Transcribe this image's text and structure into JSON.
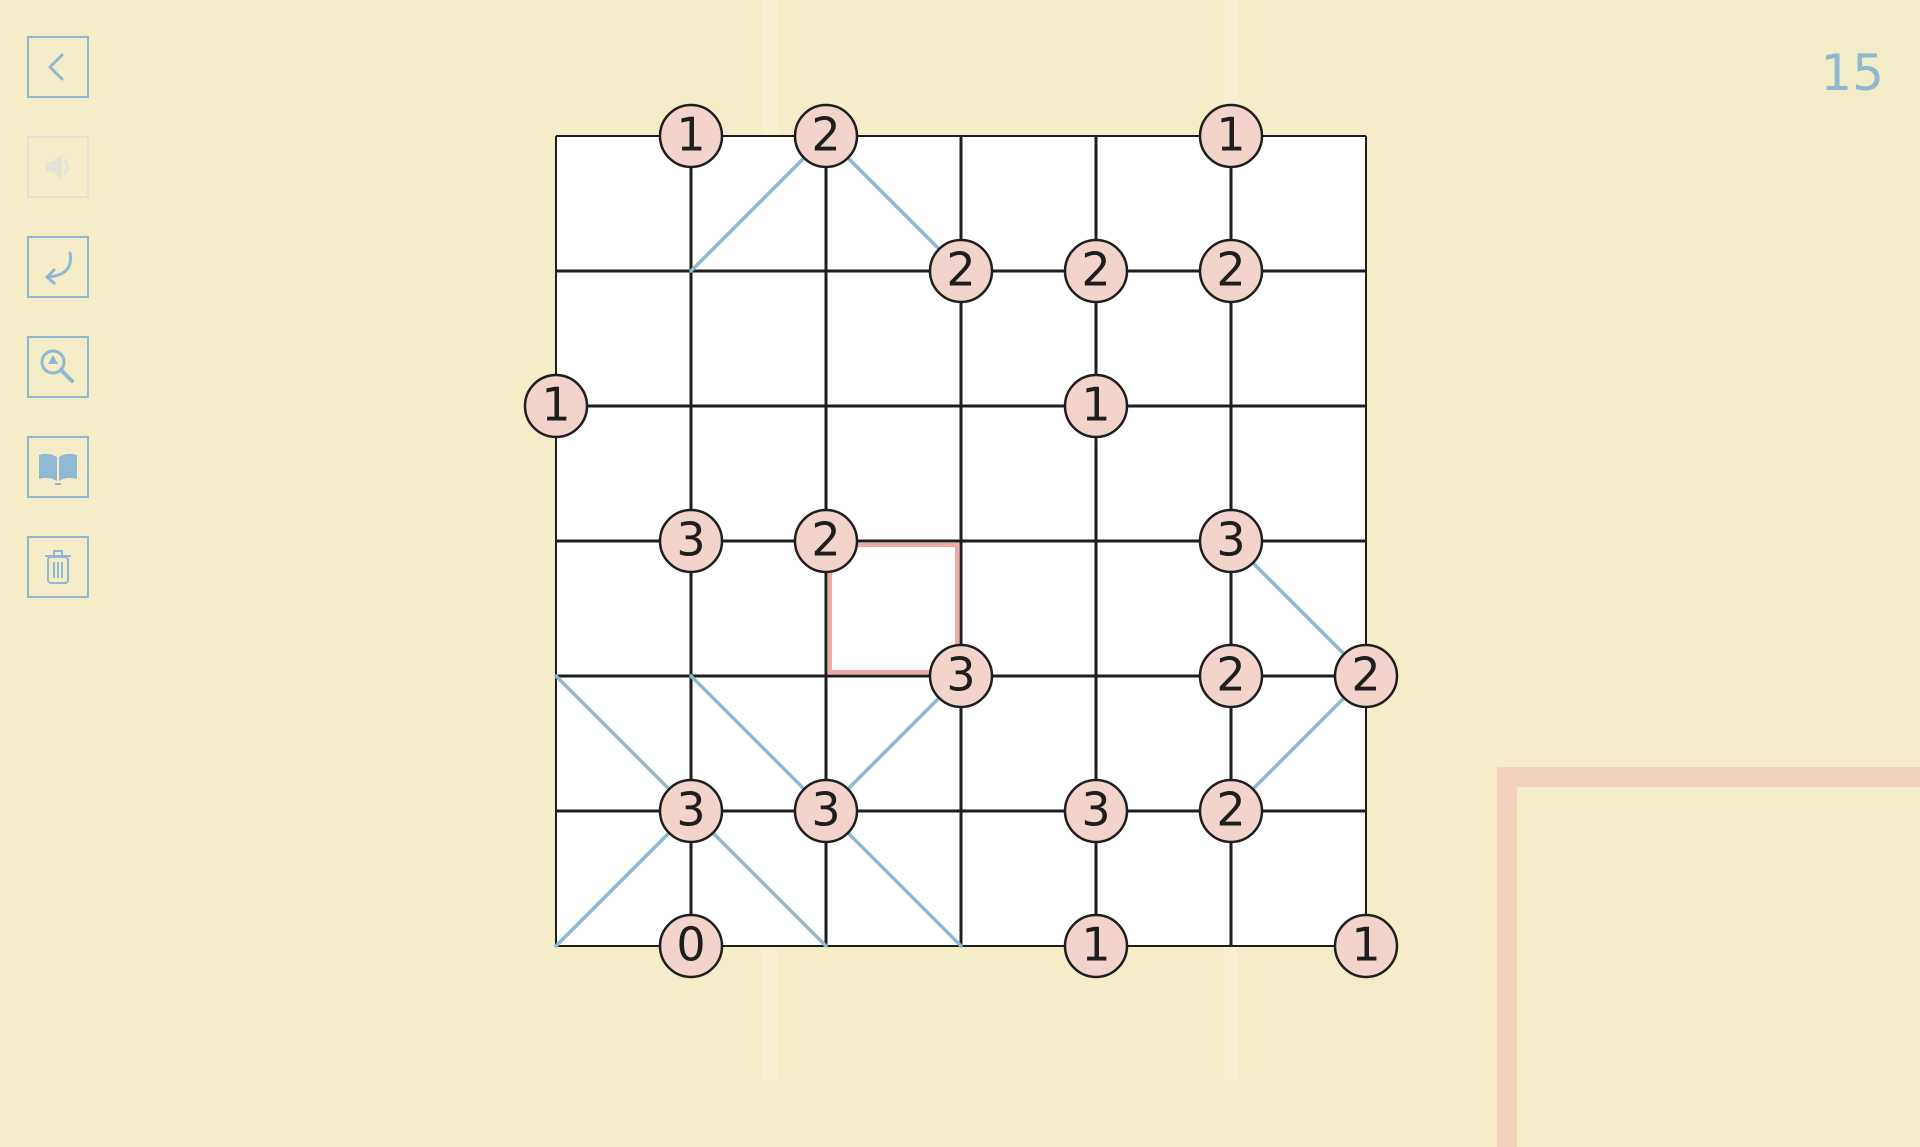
{
  "level": {
    "number": "15"
  },
  "toolbar": {
    "buttons": [
      {
        "name": "back-button",
        "icon": "chevron-left-icon",
        "enabled": true
      },
      {
        "name": "sound-button",
        "icon": "speaker-icon",
        "enabled": false
      },
      {
        "name": "undo-button",
        "icon": "undo-arrow-icon",
        "enabled": true
      },
      {
        "name": "hint-button",
        "icon": "magnifier-hint-icon",
        "enabled": true
      },
      {
        "name": "rules-button",
        "icon": "open-book-icon",
        "enabled": true
      },
      {
        "name": "clear-button",
        "icon": "trash-icon",
        "enabled": true
      }
    ]
  },
  "colors": {
    "background": "#f5ecc8",
    "grid_line": "#1e1e1e",
    "cell_fill": "#ffffff",
    "diagonal": "#8fb8d2",
    "clue_fill": "#f2d4cc",
    "clue_stroke": "#1e1e1e",
    "selection": "#f2a9a4",
    "icon": "#8fb8d2"
  },
  "puzzle": {
    "type": "slant",
    "cols": 6,
    "rows": 6,
    "clues": [
      {
        "row": 0,
        "col": 1,
        "value": "1"
      },
      {
        "row": 0,
        "col": 2,
        "value": "2"
      },
      {
        "row": 0,
        "col": 5,
        "value": "1"
      },
      {
        "row": 1,
        "col": 3,
        "value": "2"
      },
      {
        "row": 1,
        "col": 4,
        "value": "2"
      },
      {
        "row": 1,
        "col": 5,
        "value": "2"
      },
      {
        "row": 2,
        "col": 0,
        "value": "1"
      },
      {
        "row": 2,
        "col": 4,
        "value": "1"
      },
      {
        "row": 3,
        "col": 1,
        "value": "3"
      },
      {
        "row": 3,
        "col": 2,
        "value": "2"
      },
      {
        "row": 3,
        "col": 5,
        "value": "3"
      },
      {
        "row": 4,
        "col": 3,
        "value": "3"
      },
      {
        "row": 4,
        "col": 5,
        "value": "2"
      },
      {
        "row": 4,
        "col": 6,
        "value": "2"
      },
      {
        "row": 5,
        "col": 1,
        "value": "3"
      },
      {
        "row": 5,
        "col": 2,
        "value": "3"
      },
      {
        "row": 5,
        "col": 4,
        "value": "3"
      },
      {
        "row": 5,
        "col": 5,
        "value": "2"
      },
      {
        "row": 6,
        "col": 1,
        "value": "0"
      },
      {
        "row": 6,
        "col": 4,
        "value": "1"
      },
      {
        "row": 6,
        "col": 6,
        "value": "1"
      }
    ],
    "diagonals": [
      {
        "row": 0,
        "col": 1,
        "dir": "/"
      },
      {
        "row": 0,
        "col": 2,
        "dir": "\\"
      },
      {
        "row": 3,
        "col": 5,
        "dir": "\\"
      },
      {
        "row": 4,
        "col": 0,
        "dir": "\\"
      },
      {
        "row": 4,
        "col": 1,
        "dir": "\\"
      },
      {
        "row": 4,
        "col": 2,
        "dir": "/"
      },
      {
        "row": 4,
        "col": 5,
        "dir": "/"
      },
      {
        "row": 5,
        "col": 0,
        "dir": "/"
      },
      {
        "row": 5,
        "col": 1,
        "dir": "\\"
      },
      {
        "row": 5,
        "col": 2,
        "dir": "\\"
      }
    ],
    "selected_cell": {
      "row": 3,
      "col": 2
    }
  }
}
